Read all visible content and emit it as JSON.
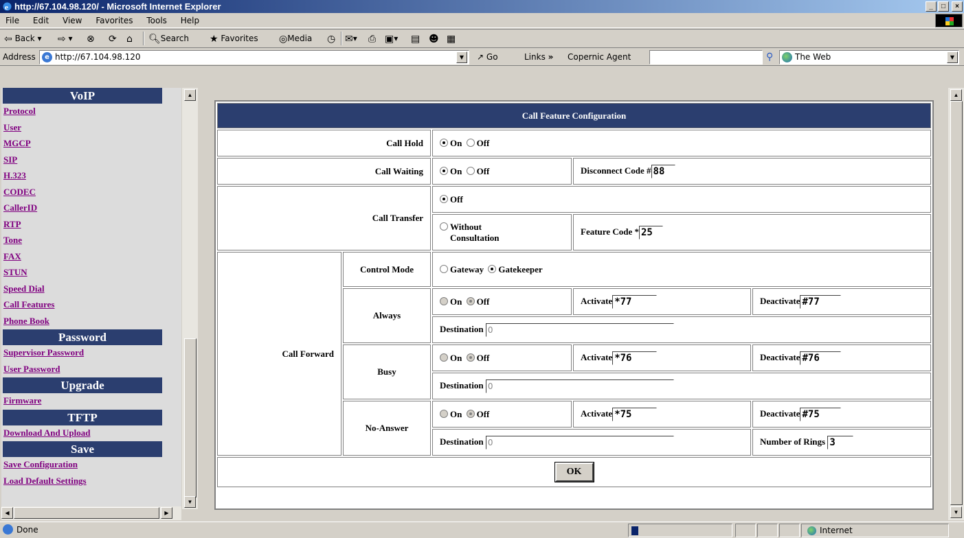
{
  "window": {
    "title": "http://67.104.98.120/ - Microsoft Internet Explorer"
  },
  "menu": [
    "File",
    "Edit",
    "View",
    "Favorites",
    "Tools",
    "Help"
  ],
  "toolbar": {
    "back": "Back",
    "search": "Search",
    "favorites": "Favorites",
    "media": "Media"
  },
  "address": {
    "label": "Address",
    "url": "http://67.104.98.120",
    "go": "Go",
    "links": "Links",
    "copernic": "Copernic Agent",
    "web": "The Web"
  },
  "nav": {
    "sections": [
      {
        "title": "VoIP",
        "links": [
          "Protocol",
          "User",
          "MGCP",
          "SIP",
          "H.323",
          "CODEC",
          "CallerID",
          "RTP",
          "Tone",
          "FAX",
          "STUN",
          "Speed Dial",
          "Call Features",
          "Phone Book"
        ]
      },
      {
        "title": "Password",
        "links": [
          "Supervisor Password",
          "User Password"
        ]
      },
      {
        "title": "Upgrade",
        "links": [
          "Firmware"
        ]
      },
      {
        "title": "TFTP",
        "links": [
          "Download And Upload"
        ]
      },
      {
        "title": "Save",
        "links": [
          "Save Configuration",
          "Load Default Settings"
        ]
      }
    ]
  },
  "form": {
    "title": "Call Feature Configuration",
    "on": "On",
    "off": "Off",
    "call_hold": {
      "label": "Call Hold",
      "value": "On"
    },
    "call_waiting": {
      "label": "Call Waiting",
      "value": "On",
      "disconnect_label": "Disconnect Code #",
      "disconnect_value": "88"
    },
    "call_transfer": {
      "label": "Call Transfer",
      "off": "Off",
      "without": "Without Consultation",
      "feature_label": "Feature Code *",
      "feature_value": "25",
      "value": "Off"
    },
    "call_forward": {
      "label": "Call Forward",
      "control_mode_label": "Control Mode",
      "gateway": "Gateway",
      "gatekeeper": "Gatekeeper",
      "control_mode_value": "Gatekeeper",
      "activate_label": "Activate",
      "deactivate_label": "Deactivate",
      "destination_label": "Destination",
      "always": {
        "label": "Always",
        "value": "Off",
        "activate": "*77",
        "deactivate": "#77",
        "destination": "0"
      },
      "busy": {
        "label": "Busy",
        "value": "Off",
        "activate": "*76",
        "deactivate": "#76",
        "destination": "0"
      },
      "no_answer": {
        "label": "No-Answer",
        "value": "Off",
        "activate": "*75",
        "deactivate": "#75",
        "destination": "0",
        "rings_label": "Number of Rings",
        "rings": "3"
      }
    },
    "ok": "OK"
  },
  "status": {
    "text": "Done",
    "zone": "Internet"
  }
}
